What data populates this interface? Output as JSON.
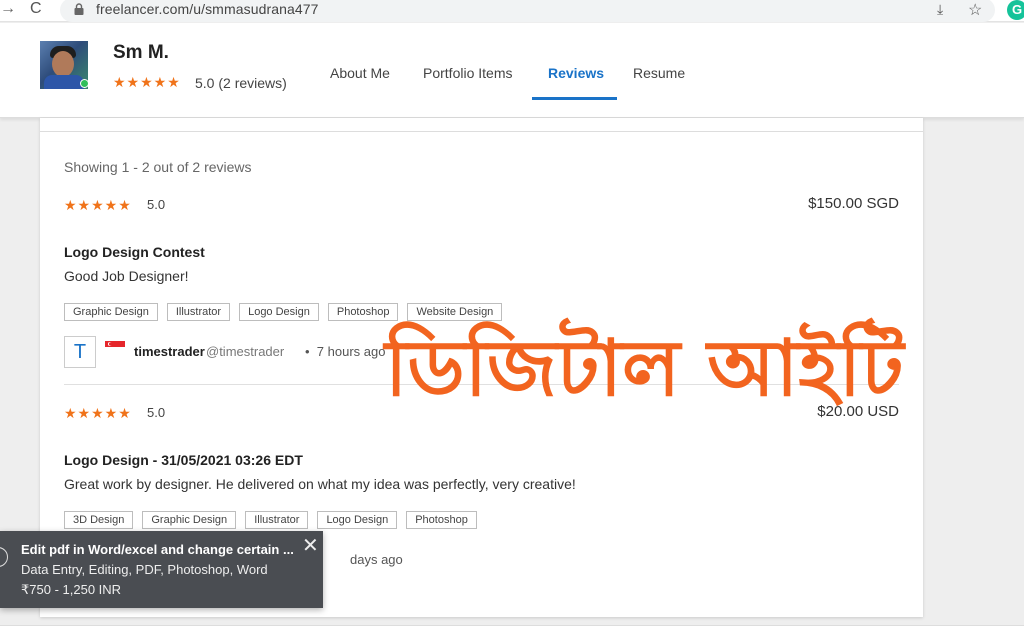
{
  "browser": {
    "url": "freelancer.com/u/smmasudrana477",
    "back_glyph": "→",
    "reload_glyph": "C",
    "download_glyph": "⤓",
    "star_glyph": "☆",
    "extension_letter": "G"
  },
  "profile": {
    "name": "Sm M.",
    "stars": "★★★★★",
    "rating_text": "5.0 (2 reviews)",
    "online_color": "#2fbf5a"
  },
  "nav": {
    "tabs": [
      {
        "label": "About Me"
      },
      {
        "label": "Portfolio Items"
      },
      {
        "label": "Reviews"
      },
      {
        "label": "Resume"
      }
    ],
    "active_tab": "Reviews",
    "accent_color": "#1a73c8"
  },
  "reviews": {
    "showing_text": "Showing 1 - 2 out of 2 reviews",
    "items": [
      {
        "stars": "★★★★★",
        "rating": "5.0",
        "amount": "$150.00 SGD",
        "project": "Logo Design Contest",
        "comment": "Good Job Designer!",
        "tags": [
          "Graphic Design",
          "Illustrator",
          "Logo Design",
          "Photoshop",
          "Website Design"
        ],
        "reviewer_initial": "T",
        "reviewer_name": "timestrader",
        "reviewer_handle": "@timestrader",
        "separator": "•",
        "time": "7 hours ago"
      },
      {
        "stars": "★★★★★",
        "rating": "5.0",
        "amount": "$20.00 USD",
        "project": "Logo Design - 31/05/2021 03:26 EDT",
        "comment": "Great work by designer. He delivered on what my idea was perfectly, very creative!",
        "tags": [
          "3D Design",
          "Graphic Design",
          "Illustrator",
          "Logo Design",
          "Photoshop"
        ],
        "time": "days ago"
      }
    ]
  },
  "watermark": {
    "text": "ডিজিটাল আইটি",
    "color": "#f2641f"
  },
  "toast": {
    "title": "Edit pdf in Word/excel and change certain ...",
    "skills": "Data Entry, Editing, PDF, Photoshop, Word",
    "budget": "₹750 - 1,250 INR",
    "close_glyph": "✕"
  },
  "colors": {
    "star": "#f0731a"
  }
}
